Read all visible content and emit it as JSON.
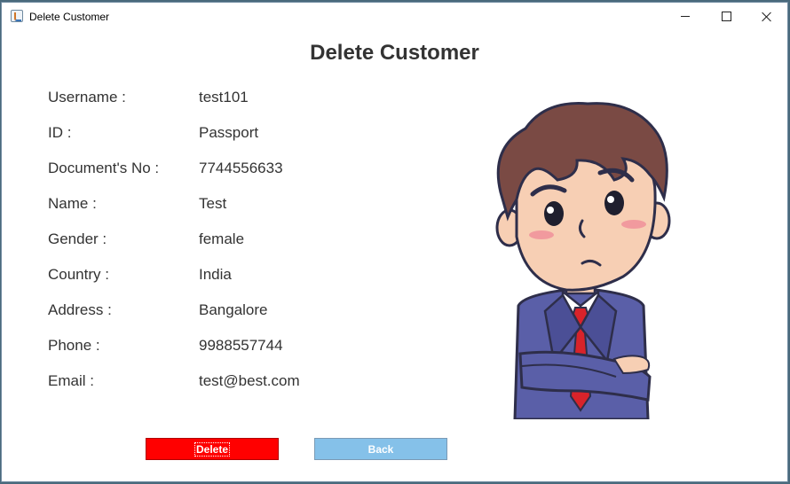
{
  "window": {
    "title": "Delete Customer"
  },
  "heading": "Delete Customer",
  "fields": [
    {
      "label": "Username  :",
      "value": "test101"
    },
    {
      "label": "ID  :",
      "value": "Passport"
    },
    {
      "label": "Document's No  :",
      "value": "7744556633"
    },
    {
      "label": "Name  :",
      "value": "Test"
    },
    {
      "label": "Gender  :",
      "value": "female"
    },
    {
      "label": "Country  :",
      "value": "India"
    },
    {
      "label": "Address  :",
      "value": "Bangalore"
    },
    {
      "label": "Phone  :",
      "value": "9988557744"
    },
    {
      "label": "Email  :",
      "value": "test@best.com"
    }
  ],
  "buttons": {
    "delete": "Delete",
    "back": "Back"
  },
  "colors": {
    "delete_bg": "#ff0000",
    "back_bg": "#85c1e9",
    "heading_text": "#333333"
  },
  "icons": {
    "window": "java-app-icon",
    "illustration": "confused-businessman"
  }
}
